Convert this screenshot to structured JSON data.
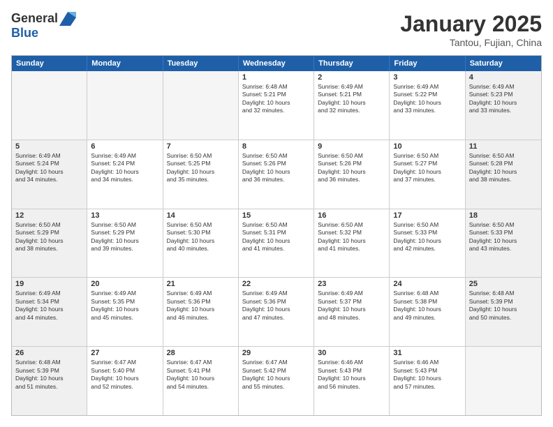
{
  "logo": {
    "general": "General",
    "blue": "Blue"
  },
  "title": "January 2025",
  "location": "Tantou, Fujian, China",
  "weekdays": [
    "Sunday",
    "Monday",
    "Tuesday",
    "Wednesday",
    "Thursday",
    "Friday",
    "Saturday"
  ],
  "weeks": [
    [
      {
        "day": "",
        "text": "",
        "empty": true
      },
      {
        "day": "",
        "text": "",
        "empty": true
      },
      {
        "day": "",
        "text": "",
        "empty": true
      },
      {
        "day": "1",
        "text": "Sunrise: 6:48 AM\nSunset: 5:21 PM\nDaylight: 10 hours\nand 32 minutes."
      },
      {
        "day": "2",
        "text": "Sunrise: 6:49 AM\nSunset: 5:21 PM\nDaylight: 10 hours\nand 32 minutes."
      },
      {
        "day": "3",
        "text": "Sunrise: 6:49 AM\nSunset: 5:22 PM\nDaylight: 10 hours\nand 33 minutes."
      },
      {
        "day": "4",
        "text": "Sunrise: 6:49 AM\nSunset: 5:23 PM\nDaylight: 10 hours\nand 33 minutes.",
        "shaded": true
      }
    ],
    [
      {
        "day": "5",
        "text": "Sunrise: 6:49 AM\nSunset: 5:24 PM\nDaylight: 10 hours\nand 34 minutes.",
        "shaded": true
      },
      {
        "day": "6",
        "text": "Sunrise: 6:49 AM\nSunset: 5:24 PM\nDaylight: 10 hours\nand 34 minutes."
      },
      {
        "day": "7",
        "text": "Sunrise: 6:50 AM\nSunset: 5:25 PM\nDaylight: 10 hours\nand 35 minutes."
      },
      {
        "day": "8",
        "text": "Sunrise: 6:50 AM\nSunset: 5:26 PM\nDaylight: 10 hours\nand 36 minutes."
      },
      {
        "day": "9",
        "text": "Sunrise: 6:50 AM\nSunset: 5:26 PM\nDaylight: 10 hours\nand 36 minutes."
      },
      {
        "day": "10",
        "text": "Sunrise: 6:50 AM\nSunset: 5:27 PM\nDaylight: 10 hours\nand 37 minutes."
      },
      {
        "day": "11",
        "text": "Sunrise: 6:50 AM\nSunset: 5:28 PM\nDaylight: 10 hours\nand 38 minutes.",
        "shaded": true
      }
    ],
    [
      {
        "day": "12",
        "text": "Sunrise: 6:50 AM\nSunset: 5:29 PM\nDaylight: 10 hours\nand 38 minutes.",
        "shaded": true
      },
      {
        "day": "13",
        "text": "Sunrise: 6:50 AM\nSunset: 5:29 PM\nDaylight: 10 hours\nand 39 minutes."
      },
      {
        "day": "14",
        "text": "Sunrise: 6:50 AM\nSunset: 5:30 PM\nDaylight: 10 hours\nand 40 minutes."
      },
      {
        "day": "15",
        "text": "Sunrise: 6:50 AM\nSunset: 5:31 PM\nDaylight: 10 hours\nand 41 minutes."
      },
      {
        "day": "16",
        "text": "Sunrise: 6:50 AM\nSunset: 5:32 PM\nDaylight: 10 hours\nand 41 minutes."
      },
      {
        "day": "17",
        "text": "Sunrise: 6:50 AM\nSunset: 5:33 PM\nDaylight: 10 hours\nand 42 minutes."
      },
      {
        "day": "18",
        "text": "Sunrise: 6:50 AM\nSunset: 5:33 PM\nDaylight: 10 hours\nand 43 minutes.",
        "shaded": true
      }
    ],
    [
      {
        "day": "19",
        "text": "Sunrise: 6:49 AM\nSunset: 5:34 PM\nDaylight: 10 hours\nand 44 minutes.",
        "shaded": true
      },
      {
        "day": "20",
        "text": "Sunrise: 6:49 AM\nSunset: 5:35 PM\nDaylight: 10 hours\nand 45 minutes."
      },
      {
        "day": "21",
        "text": "Sunrise: 6:49 AM\nSunset: 5:36 PM\nDaylight: 10 hours\nand 46 minutes."
      },
      {
        "day": "22",
        "text": "Sunrise: 6:49 AM\nSunset: 5:36 PM\nDaylight: 10 hours\nand 47 minutes."
      },
      {
        "day": "23",
        "text": "Sunrise: 6:49 AM\nSunset: 5:37 PM\nDaylight: 10 hours\nand 48 minutes."
      },
      {
        "day": "24",
        "text": "Sunrise: 6:48 AM\nSunset: 5:38 PM\nDaylight: 10 hours\nand 49 minutes."
      },
      {
        "day": "25",
        "text": "Sunrise: 6:48 AM\nSunset: 5:39 PM\nDaylight: 10 hours\nand 50 minutes.",
        "shaded": true
      }
    ],
    [
      {
        "day": "26",
        "text": "Sunrise: 6:48 AM\nSunset: 5:39 PM\nDaylight: 10 hours\nand 51 minutes.",
        "shaded": true
      },
      {
        "day": "27",
        "text": "Sunrise: 6:47 AM\nSunset: 5:40 PM\nDaylight: 10 hours\nand 52 minutes."
      },
      {
        "day": "28",
        "text": "Sunrise: 6:47 AM\nSunset: 5:41 PM\nDaylight: 10 hours\nand 54 minutes."
      },
      {
        "day": "29",
        "text": "Sunrise: 6:47 AM\nSunset: 5:42 PM\nDaylight: 10 hours\nand 55 minutes."
      },
      {
        "day": "30",
        "text": "Sunrise: 6:46 AM\nSunset: 5:43 PM\nDaylight: 10 hours\nand 56 minutes."
      },
      {
        "day": "31",
        "text": "Sunrise: 6:46 AM\nSunset: 5:43 PM\nDaylight: 10 hours\nand 57 minutes."
      },
      {
        "day": "",
        "text": "",
        "empty": true
      }
    ]
  ]
}
